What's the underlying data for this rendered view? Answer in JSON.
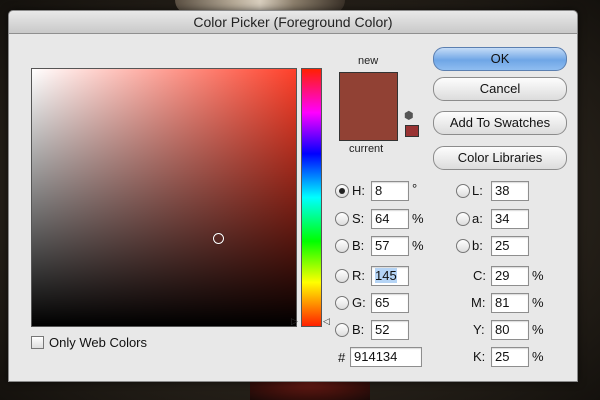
{
  "window": {
    "title": "Color Picker (Foreground Color)"
  },
  "preview": {
    "new_label": "new",
    "current_label": "current",
    "new_color": "#914134",
    "current_color": "#914134",
    "websafe_color": "#993333"
  },
  "buttons": {
    "ok": "OK",
    "cancel": "Cancel",
    "add_to_swatches": "Add To Swatches",
    "color_libraries": "Color Libraries"
  },
  "hsb": {
    "h": {
      "label": "H:",
      "value": "8",
      "unit": "°"
    },
    "s": {
      "label": "S:",
      "value": "64",
      "unit": "%"
    },
    "b": {
      "label": "B:",
      "value": "57",
      "unit": "%"
    }
  },
  "rgb": {
    "r": {
      "label": "R:",
      "value": "145"
    },
    "g": {
      "label": "G:",
      "value": "65"
    },
    "b": {
      "label": "B:",
      "value": "52"
    }
  },
  "lab": {
    "l": {
      "label": "L:",
      "value": "38"
    },
    "a": {
      "label": "a:",
      "value": "34"
    },
    "b": {
      "label": "b:",
      "value": "25"
    }
  },
  "cmyk": {
    "c": {
      "label": "C:",
      "value": "29",
      "unit": "%"
    },
    "m": {
      "label": "M:",
      "value": "81",
      "unit": "%"
    },
    "y": {
      "label": "Y:",
      "value": "80",
      "unit": "%"
    },
    "k": {
      "label": "K:",
      "value": "25",
      "unit": "%"
    }
  },
  "hex": {
    "label": "#",
    "value": "914134"
  },
  "only_web_colors": {
    "label": "Only Web Colors",
    "checked": false
  },
  "icons": {
    "gamut_warning": "cube-icon",
    "hue_slider_arrows": "triangle-icon"
  }
}
